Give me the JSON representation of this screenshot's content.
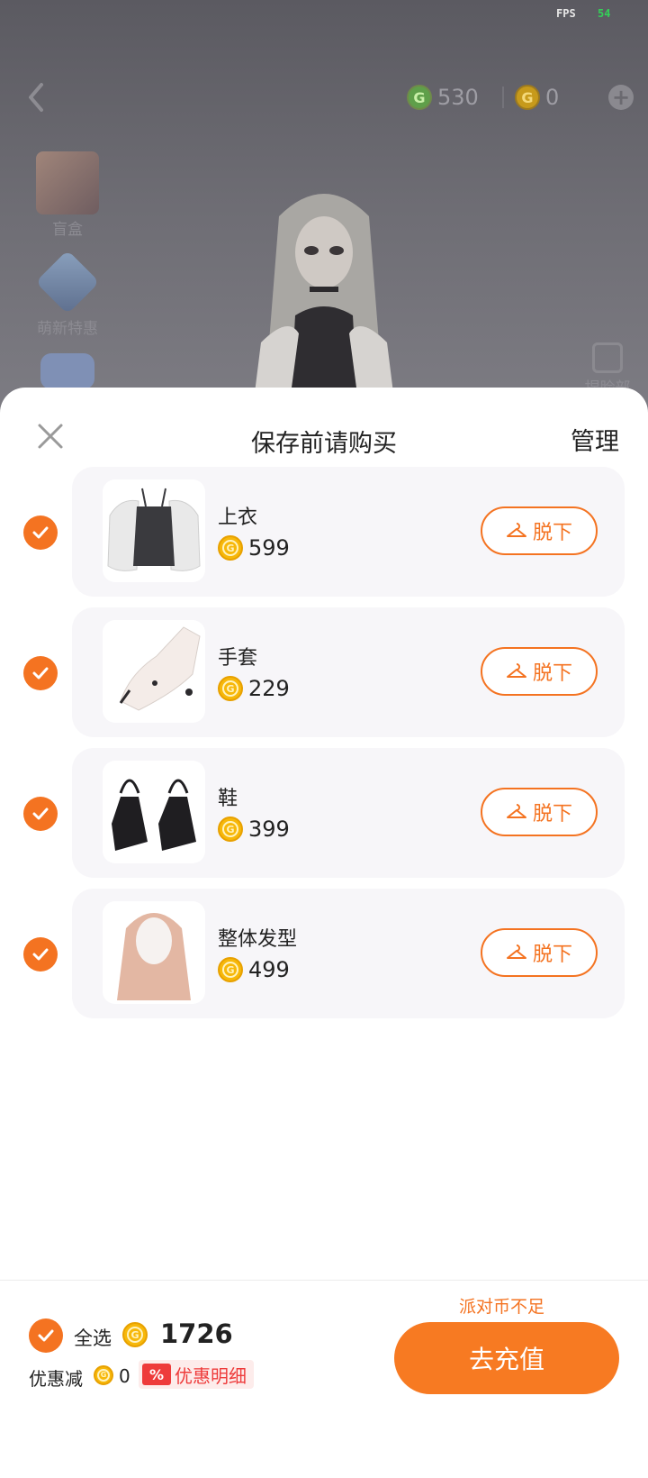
{
  "status": {
    "fps_label": "FPS",
    "fps_value": "54"
  },
  "top_bar": {
    "green_currency": {
      "icon": "green-coin-icon",
      "value": "530"
    },
    "gold_currency": {
      "icon": "gold-coin-icon",
      "value": "0"
    },
    "add_icon": "plus-circle-icon"
  },
  "side_menu": [
    {
      "label": "盲盒",
      "icon": "gift-box-icon"
    },
    {
      "label": "萌新特惠",
      "icon": "newbie-offer-icon"
    }
  ],
  "face_edit": {
    "label": "捏脸部",
    "icon": "edit-icon"
  },
  "sheet": {
    "title": "保存前请购买",
    "manage_label": "管理"
  },
  "items": [
    {
      "name": "上衣",
      "price": "599",
      "action": "脱下",
      "checked": true
    },
    {
      "name": "手套",
      "price": "229",
      "action": "脱下",
      "checked": true
    },
    {
      "name": "鞋",
      "price": "399",
      "action": "脱下",
      "checked": true
    },
    {
      "name": "整体发型",
      "price": "499",
      "action": "脱下",
      "checked": true
    }
  ],
  "footer": {
    "insufficient_text": "派对币不足",
    "select_all_label": "全选",
    "total": "1726",
    "discount_label": "优惠减",
    "discount_value": "0",
    "detail_badge": "%",
    "detail_label": "优惠明细",
    "recharge_label": "去充值"
  },
  "colors": {
    "accent": "#f47321",
    "coin": "#f7b80a",
    "red": "#ee3b3b"
  }
}
